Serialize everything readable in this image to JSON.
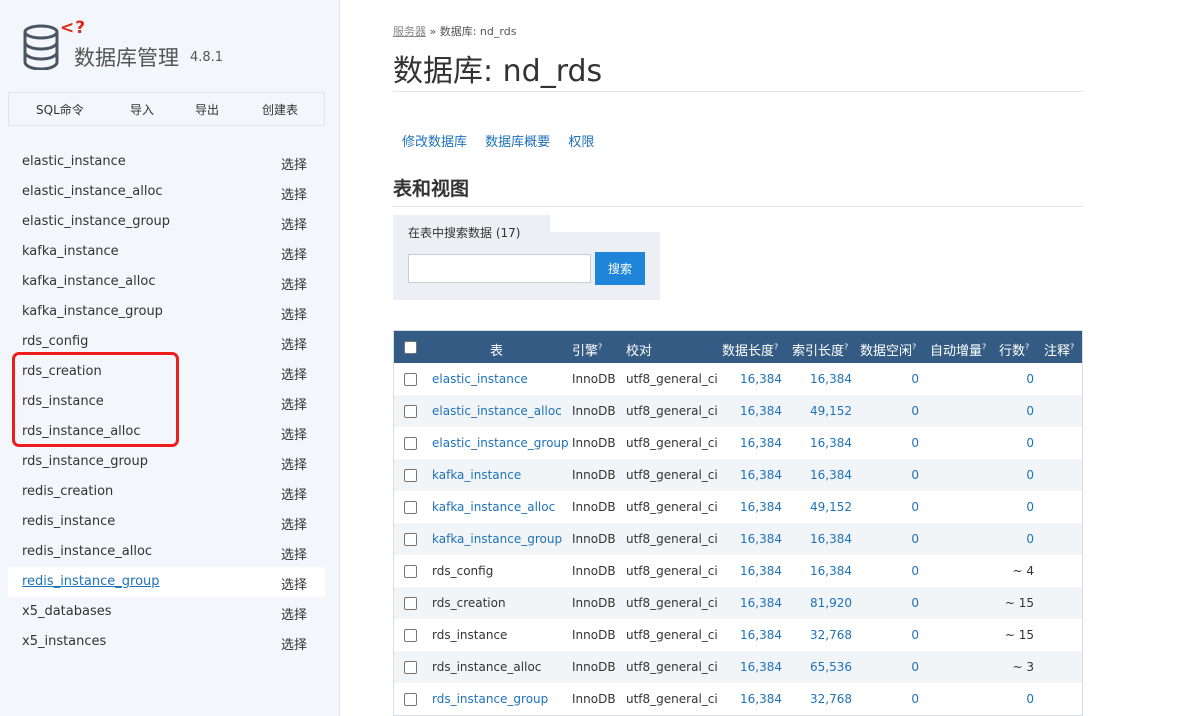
{
  "app": {
    "brand_mark": "<?",
    "name": "数据库管理",
    "version": "4.8.1",
    "icon": "database-icon"
  },
  "menu": {
    "sql_command": "SQL命令",
    "import": "导入",
    "export": "导出",
    "create_table": "创建表"
  },
  "sidebar": {
    "select_label": "选择",
    "tables": [
      {
        "name": "elastic_instance"
      },
      {
        "name": "elastic_instance_alloc"
      },
      {
        "name": "elastic_instance_group"
      },
      {
        "name": "kafka_instance"
      },
      {
        "name": "kafka_instance_alloc"
      },
      {
        "name": "kafka_instance_group"
      },
      {
        "name": "rds_config"
      },
      {
        "name": "rds_creation"
      },
      {
        "name": "rds_instance"
      },
      {
        "name": "rds_instance_alloc"
      },
      {
        "name": "rds_instance_group"
      },
      {
        "name": "redis_creation"
      },
      {
        "name": "redis_instance"
      },
      {
        "name": "redis_instance_alloc"
      },
      {
        "name": "redis_instance_group",
        "active": true
      },
      {
        "name": "x5_databases"
      },
      {
        "name": "x5_instances"
      }
    ],
    "highlight_color": "#ee1c1c"
  },
  "breadcrumb": {
    "server": "服务器",
    "separator": " » ",
    "current": "数据库: nd_rds"
  },
  "page": {
    "title": "数据库: nd_rds"
  },
  "db_links": {
    "alter": "修改数据库",
    "schema": "数据库概要",
    "privileges": "权限"
  },
  "section": {
    "title": "表和视图"
  },
  "search": {
    "legend": "在表中搜索数据 (17)",
    "value": "",
    "button": "搜索"
  },
  "table": {
    "headers": {
      "name": "表",
      "engine": "引擎",
      "collation": "校对",
      "data_length": "数据长度",
      "index_length": "索引长度",
      "data_free": "数据空闲",
      "auto_increment": "自动增量",
      "rows": "行数",
      "comment": "注释",
      "help_mark": "?"
    },
    "rows": [
      {
        "name": "elastic_instance",
        "linked": true,
        "engine": "InnoDB",
        "collation": "utf8_general_ci",
        "data_length": "16,384",
        "index_length": "16,384",
        "data_free": "0",
        "rows": "0"
      },
      {
        "name": "elastic_instance_alloc",
        "linked": true,
        "engine": "InnoDB",
        "collation": "utf8_general_ci",
        "data_length": "16,384",
        "index_length": "49,152",
        "data_free": "0",
        "rows": "0"
      },
      {
        "name": "elastic_instance_group",
        "linked": true,
        "engine": "InnoDB",
        "collation": "utf8_general_ci",
        "data_length": "16,384",
        "index_length": "16,384",
        "data_free": "0",
        "rows": "0"
      },
      {
        "name": "kafka_instance",
        "linked": true,
        "engine": "InnoDB",
        "collation": "utf8_general_ci",
        "data_length": "16,384",
        "index_length": "16,384",
        "data_free": "0",
        "rows": "0"
      },
      {
        "name": "kafka_instance_alloc",
        "linked": true,
        "engine": "InnoDB",
        "collation": "utf8_general_ci",
        "data_length": "16,384",
        "index_length": "49,152",
        "data_free": "0",
        "rows": "0"
      },
      {
        "name": "kafka_instance_group",
        "linked": true,
        "engine": "InnoDB",
        "collation": "utf8_general_ci",
        "data_length": "16,384",
        "index_length": "16,384",
        "data_free": "0",
        "rows": "0"
      },
      {
        "name": "rds_config",
        "linked": false,
        "engine": "InnoDB",
        "collation": "utf8_general_ci",
        "data_length": "16,384",
        "index_length": "16,384",
        "data_free": "0",
        "rows": "~ 4"
      },
      {
        "name": "rds_creation",
        "linked": false,
        "engine": "InnoDB",
        "collation": "utf8_general_ci",
        "data_length": "16,384",
        "index_length": "81,920",
        "data_free": "0",
        "rows": "~ 15"
      },
      {
        "name": "rds_instance",
        "linked": false,
        "engine": "InnoDB",
        "collation": "utf8_general_ci",
        "data_length": "16,384",
        "index_length": "32,768",
        "data_free": "0",
        "rows": "~ 15"
      },
      {
        "name": "rds_instance_alloc",
        "linked": false,
        "engine": "InnoDB",
        "collation": "utf8_general_ci",
        "data_length": "16,384",
        "index_length": "65,536",
        "data_free": "0",
        "rows": "~ 3"
      },
      {
        "name": "rds_instance_group",
        "linked": true,
        "engine": "InnoDB",
        "collation": "utf8_general_ci",
        "data_length": "16,384",
        "index_length": "32,768",
        "data_free": "0",
        "rows": "0"
      }
    ]
  },
  "colors": {
    "link": "#1e72b8",
    "header_bg": "#335b84",
    "button_bg": "#1f85d9",
    "sidebar_bg": "#f3f6fa"
  }
}
